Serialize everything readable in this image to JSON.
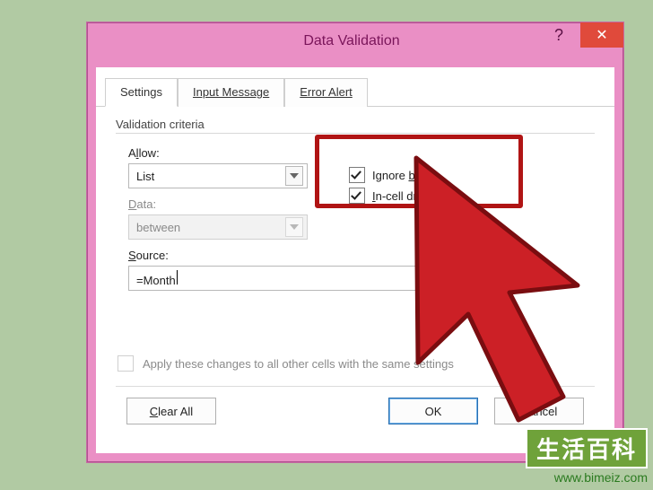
{
  "title": "Data Validation",
  "tabs": {
    "settings": "Settings",
    "input_message": "Input Message",
    "error_alert": "Error Alert"
  },
  "section_label": "Validation criteria",
  "allow": {
    "label_pre": "A",
    "label_u": "l",
    "label_post": "low:",
    "value": "List"
  },
  "data": {
    "label_pre": "",
    "label_u": "D",
    "label_post": "ata:",
    "value": "between"
  },
  "ignore_blank": {
    "pre": "Ignore ",
    "u": "b",
    "post": "lank",
    "checked": true
  },
  "incell": {
    "pre": "",
    "u": "I",
    "post": "n-cell dropdown",
    "checked": true
  },
  "source": {
    "label_pre": "",
    "label_u": "S",
    "label_post": "ource:",
    "value": "=Month"
  },
  "apply": {
    "pre": "Apply these changes to all other cells with the same settings",
    "u": "",
    "post": "",
    "checked": false
  },
  "buttons": {
    "clear_pre": "",
    "clear_u": "C",
    "clear_post": "lear All",
    "ok": "OK",
    "cancel": "Cancel"
  },
  "help": "?",
  "close": "✕",
  "watermark": {
    "cn": "生活百科",
    "url": "www.bimeiz.com"
  }
}
